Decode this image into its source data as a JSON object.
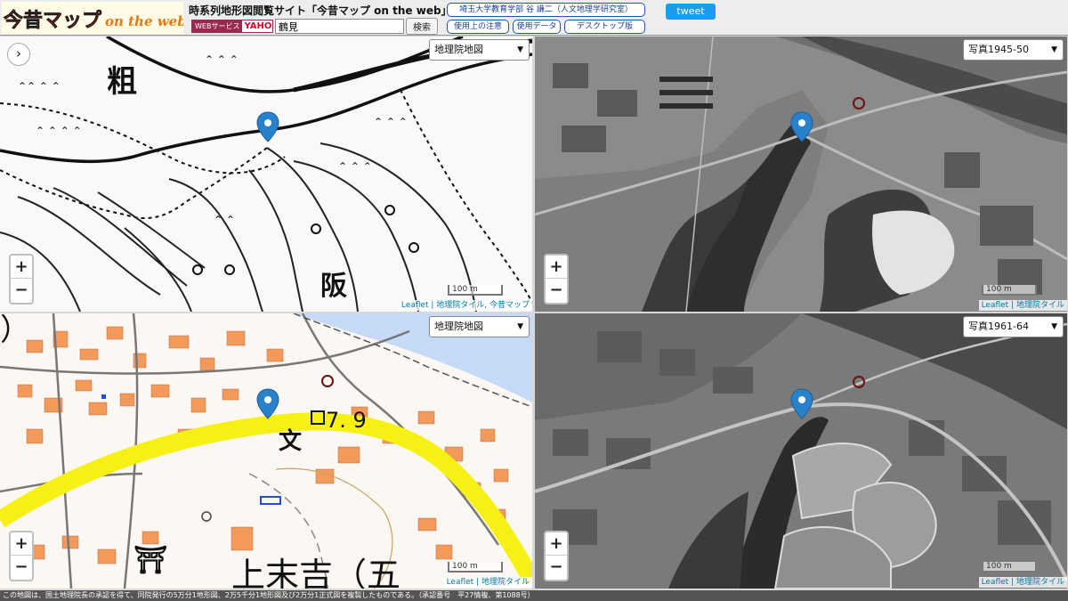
{
  "header": {
    "logo_main": "今昔マップ",
    "logo_sub": "on the web",
    "site_title": "時系列地形図閲覧サイト「今昔マップ on the web」",
    "badge_service": "WEBサービス",
    "badge_brand": "YAHOO!",
    "search_value": "鶴見",
    "search_button": "検索",
    "links": {
      "author": "埼玉大学教育学部 谷 謙二（人文地理学研究室）",
      "notes": "使用上の注意",
      "data": "使用データ",
      "desktop": "デスクトップ版"
    },
    "tweet": "tweet"
  },
  "panels": [
    {
      "layer": "地理院地図",
      "scale": "100 m",
      "attribution_links": [
        "Leaflet",
        "地理院タイル, 今昔マップ"
      ]
    },
    {
      "layer": "写真1945-50",
      "scale": "100 m",
      "attribution_links": [
        "Leaflet",
        "地理院タイル"
      ]
    },
    {
      "layer": "地理院地図",
      "scale": "100 m",
      "attribution_links": [
        "Leaflet",
        "地理院タイル"
      ],
      "map_labels": [
        "7. 9",
        "文",
        "上末吉（五"
      ]
    },
    {
      "layer": "写真1961-64",
      "scale": "100 m",
      "attribution_links": [
        "Leaflet",
        "地理院タイル"
      ]
    }
  ],
  "zoom": {
    "in": "+",
    "out": "−"
  },
  "footer": "この地図は、国土地理院長の承認を得て、同院発行の5万分1地形図、2万5千分1地形図及び2万分1正式図を複製したものである。（承認番号　平27情複、第1088号）",
  "colors": {
    "marker": "#2a81cb",
    "highlight_road": "#f6f014",
    "building": "#f2995b",
    "river": "#c6d9f7",
    "attribution_link": "#0078a8"
  }
}
